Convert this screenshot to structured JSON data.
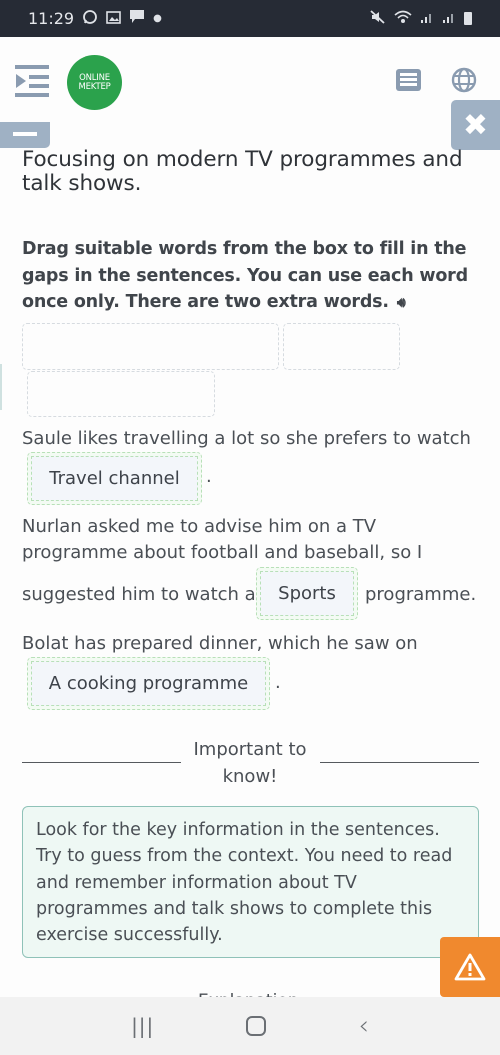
{
  "status_bar": {
    "time": "11:29",
    "notification_icons": [
      "whatsapp-icon",
      "gallery-icon",
      "message-icon",
      "dot-icon"
    ],
    "system_icons": [
      "mute-icon",
      "wifi-icon",
      "signal-icon",
      "signal-icon",
      "battery-icon"
    ]
  },
  "header": {
    "logo_line1": "ONLINE",
    "logo_line2": "MEKTEP",
    "brand_color": "#2ba24c"
  },
  "exercise": {
    "title": "Focusing on modern TV programmes and talk shows.",
    "instruction": "Drag suitable words from the box to fill in the gaps in the sentences. You can use each word once only. There are two extra words.",
    "word_bank_slots": 3,
    "sentences": [
      {
        "before": "Saule likes travelling a lot so she prefers to watch",
        "answer": "Travel channel",
        "after": "."
      },
      {
        "before_line1": "Nurlan asked me to advise him on a TV",
        "before_line2": "programme about football and baseball, so I",
        "before_line3": "suggested him to watch a",
        "answer": "Sports",
        "after": "programme."
      },
      {
        "before": "Bolat has prepared dinner, which he saw on",
        "answer": "A cooking programme",
        "after": "."
      }
    ]
  },
  "important": {
    "heading_line1": "Important to",
    "heading_line2": "know!",
    "tip": "Look for the key information in the sentences. Try to guess from the context. You need to read and remember information about TV programmes and talk shows to complete this exercise successfully."
  },
  "explanation_label": "Explanation",
  "colors": {
    "tip_bg": "#eef8f4",
    "warning": "#f0892e",
    "accent_gray": "#8a9bb0"
  }
}
